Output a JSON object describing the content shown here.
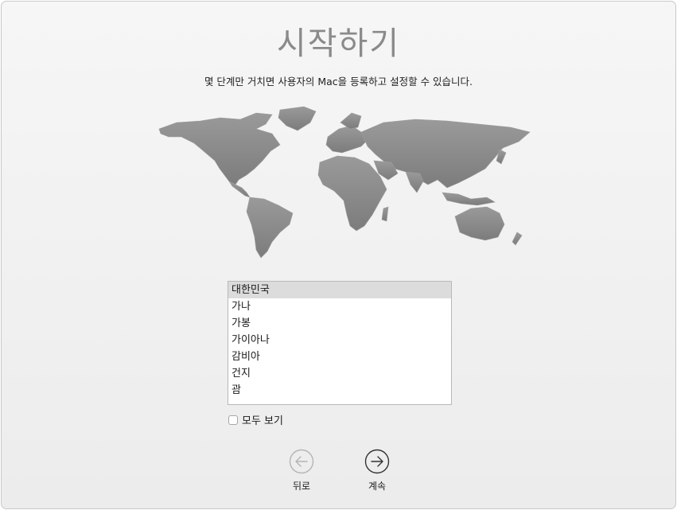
{
  "header": {
    "title": "시작하기",
    "subtitle": "몇 단계만 거치면 사용자의 Mac을 등록하고 설정할 수 있습니다."
  },
  "country_list": {
    "items": [
      {
        "label": "대한민국",
        "selected": true
      },
      {
        "label": "가나",
        "selected": false
      },
      {
        "label": "가봉",
        "selected": false
      },
      {
        "label": "가이아나",
        "selected": false
      },
      {
        "label": "감비아",
        "selected": false
      },
      {
        "label": "건지",
        "selected": false
      },
      {
        "label": "괌",
        "selected": false
      }
    ]
  },
  "show_all": {
    "label": "모두 보기",
    "checked": false
  },
  "navigation": {
    "back_label": "뒤로",
    "continue_label": "계속"
  },
  "icons": {
    "back": "arrow-left-icon",
    "continue": "arrow-right-icon"
  },
  "colors": {
    "title": "#8a8a8a",
    "map_fill": "#8f8f8f",
    "selection": "#dcdcdc"
  }
}
